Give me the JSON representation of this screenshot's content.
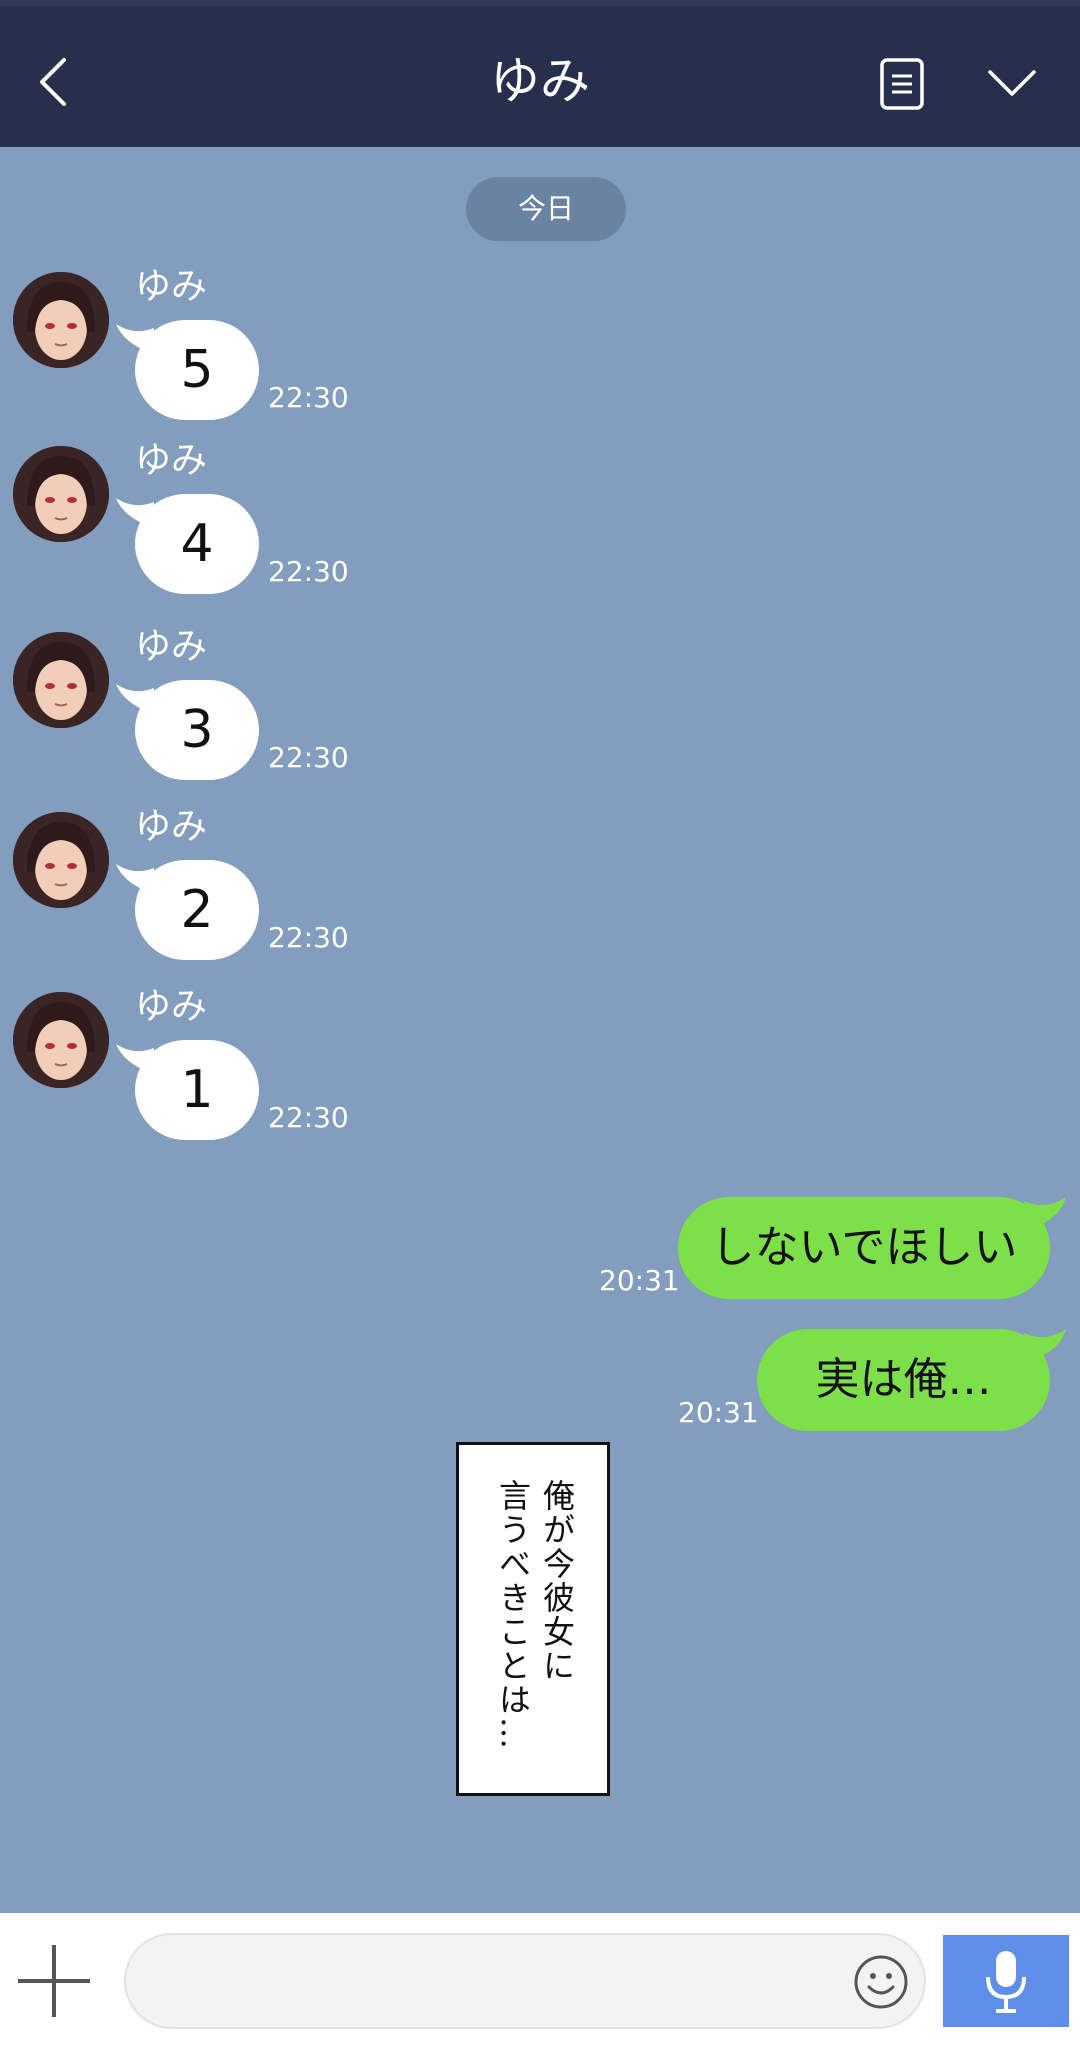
{
  "header": {
    "title": "ゆみ",
    "icons": {
      "back": "chevron-left-icon",
      "notes": "notes-icon",
      "menu": "chevron-down-icon"
    }
  },
  "chat": {
    "date_label": "今日",
    "incoming": [
      {
        "sender": "ゆみ",
        "text": "5",
        "time": "22:30"
      },
      {
        "sender": "ゆみ",
        "text": "4",
        "time": "22:30"
      },
      {
        "sender": "ゆみ",
        "text": "3",
        "time": "22:30"
      },
      {
        "sender": "ゆみ",
        "text": "2",
        "time": "22:30"
      },
      {
        "sender": "ゆみ",
        "text": "1",
        "time": "22:30"
      }
    ],
    "outgoing": [
      {
        "text": "しないでほしい",
        "time": "20:31"
      },
      {
        "text": "実は俺…",
        "time": "20:31"
      }
    ]
  },
  "caption": {
    "line1": "俺が今彼女に",
    "line2": "言うべきことは…"
  },
  "input_bar": {
    "message_value": "",
    "icons": {
      "add": "plus-icon",
      "emoji": "smiley-icon",
      "voice": "microphone-icon"
    }
  },
  "colors": {
    "header_bg": "#26304d",
    "chat_bg": "#829dbe",
    "outgoing_bubble": "#7de048",
    "incoming_bubble": "#ffffff",
    "mic_button": "#5f8ee8"
  }
}
